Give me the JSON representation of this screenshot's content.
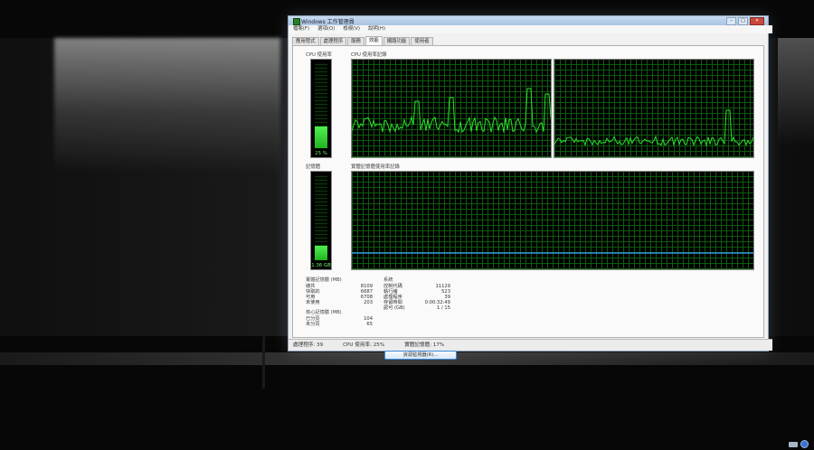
{
  "window": {
    "title": "Windows 工作管理員",
    "controls": [
      "–",
      "□",
      "✕"
    ]
  },
  "menu": [
    "檔案(F)",
    "選項(O)",
    "檢視(V)",
    "說明(H)"
  ],
  "tabs": [
    {
      "label": "應用程式",
      "active": false
    },
    {
      "label": "處理程序",
      "active": false
    },
    {
      "label": "服務",
      "active": false
    },
    {
      "label": "效能",
      "active": true
    },
    {
      "label": "網路功能",
      "active": false
    },
    {
      "label": "使用者",
      "active": false
    }
  ],
  "cpu": {
    "usage_label": "CPU 使用率",
    "history_label": "CPU 使用率記錄",
    "value": "25 %",
    "fraction": 0.25
  },
  "memory": {
    "usage_label": "記憶體",
    "history_label": "實體記憶體使用率記錄",
    "value": "1.36 GB",
    "fraction": 0.17
  },
  "physical_memory": {
    "title": "實體記憶體 (MB)",
    "rows": [
      {
        "label": "總共",
        "value": "8109"
      },
      {
        "label": "快取的",
        "value": "6687"
      },
      {
        "label": "可用",
        "value": "6708"
      },
      {
        "label": "未使用",
        "value": "203"
      }
    ]
  },
  "kernel_memory": {
    "title": "核心記憶體 (MB)",
    "rows": [
      {
        "label": "已分頁",
        "value": "104"
      },
      {
        "label": "未分頁",
        "value": "65"
      }
    ]
  },
  "system": {
    "title": "系統",
    "rows": [
      {
        "label": "控制代碼",
        "value": "11129"
      },
      {
        "label": "執行緒",
        "value": "523"
      },
      {
        "label": "處理程序",
        "value": "39"
      },
      {
        "label": "存留時間",
        "value": "0:00:32:49"
      },
      {
        "label": "認可 (GB)",
        "value": "1 / 15"
      }
    ]
  },
  "resource_monitor_button": "資源監視器(R)...",
  "status": {
    "processes": "處理程序: 39",
    "cpu": "CPU 使用率: 25%",
    "memory": "實體記憶體: 17%"
  },
  "colors": {
    "graph_line": "#2ce02c",
    "memory_line": "#3aa9ff",
    "grid": "#0f5a0f"
  }
}
